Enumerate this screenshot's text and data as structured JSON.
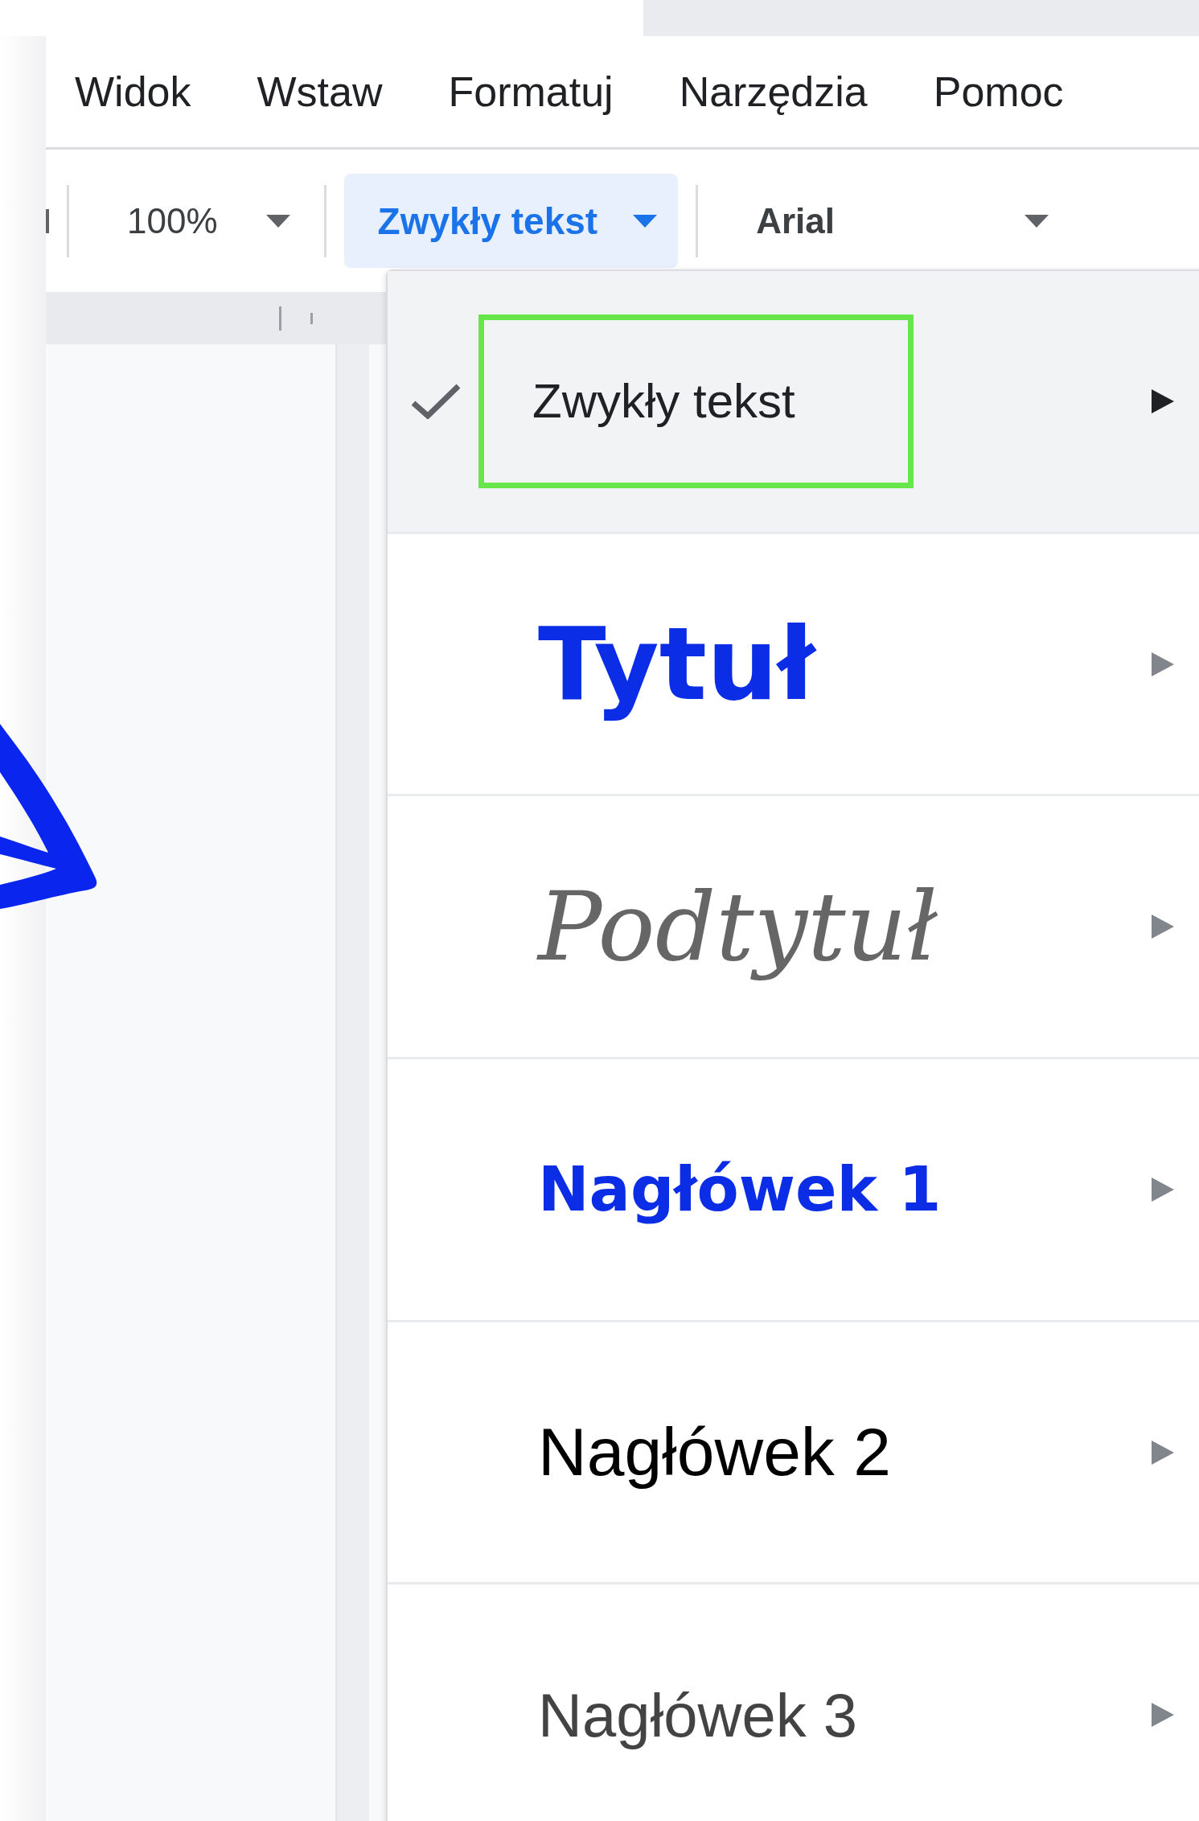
{
  "menu_bar": [
    {
      "label": "Widok"
    },
    {
      "label": "Wstaw"
    },
    {
      "label": "Formatuj"
    },
    {
      "label": "Narzędzia"
    },
    {
      "label": "Pomoc"
    }
  ],
  "toolbar": {
    "zoom": "100%",
    "style": "Zwykły tekst",
    "font": "Arial"
  },
  "style_menu": {
    "items": [
      {
        "label": "Zwykły tekst",
        "kind": "normal",
        "selected": true,
        "highlighted": true
      },
      {
        "label": "Tytuł",
        "kind": "title",
        "selected": false,
        "highlighted": false
      },
      {
        "label": "Podtytuł",
        "kind": "subtitle",
        "selected": false,
        "highlighted": false
      },
      {
        "label": "Nagłówek 1",
        "kind": "heading1",
        "selected": false,
        "highlighted": false
      },
      {
        "label": "Nagłówek 2",
        "kind": "heading2",
        "selected": false,
        "highlighted": false
      },
      {
        "label": "Nagłówek 3",
        "kind": "heading3",
        "selected": false,
        "highlighted": false
      }
    ]
  }
}
